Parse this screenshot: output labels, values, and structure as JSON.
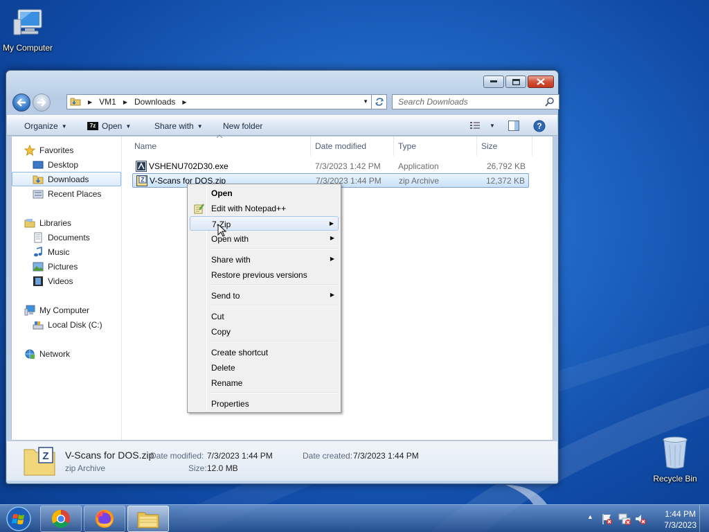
{
  "desktop": {
    "icons": [
      {
        "label": "My Computer"
      },
      {
        "label": "Recycle Bin"
      }
    ]
  },
  "explorer": {
    "breadcrumb": [
      "VM1",
      "Downloads"
    ],
    "search_placeholder": "Search Downloads",
    "toolbar": {
      "organize": "Organize",
      "open": "Open",
      "share_with": "Share with",
      "new_folder": "New folder"
    },
    "nav": {
      "favorites": "Favorites",
      "desktop": "Desktop",
      "downloads": "Downloads",
      "recent_places": "Recent Places",
      "libraries": "Libraries",
      "documents": "Documents",
      "music": "Music",
      "pictures": "Pictures",
      "videos": "Videos",
      "my_computer": "My Computer",
      "local_disk": "Local Disk (C:)",
      "network": "Network"
    },
    "columns": [
      "Name",
      "Date modified",
      "Type",
      "Size"
    ],
    "files": [
      {
        "name": "VSHENU702D30.exe",
        "date": "7/3/2023 1:42 PM",
        "type": "Application",
        "size": "26,792 KB"
      },
      {
        "name": "V-Scans for DOS.zip",
        "date": "7/3/2023 1:44 PM",
        "type": "zip Archive",
        "size": "12,372 KB"
      }
    ],
    "details": {
      "name": "V-Scans for DOS.zip",
      "type": "zip Archive",
      "modified_label": "Date modified:",
      "modified_value": "7/3/2023 1:44 PM",
      "created_label": "Date created:",
      "created_value": "7/3/2023 1:44 PM",
      "size_label": "Size:",
      "size_value": "12.0 MB"
    }
  },
  "context_menu": {
    "open": "Open",
    "edit_notepad": "Edit with Notepad++",
    "seven_zip": "7-Zip",
    "open_with": "Open with",
    "share_with": "Share with",
    "restore": "Restore previous versions",
    "send_to": "Send to",
    "cut": "Cut",
    "copy": "Copy",
    "create_shortcut": "Create shortcut",
    "delete": "Delete",
    "rename": "Rename",
    "properties": "Properties"
  },
  "taskbar": {
    "time": "1:44 PM",
    "date": "7/3/2023"
  }
}
